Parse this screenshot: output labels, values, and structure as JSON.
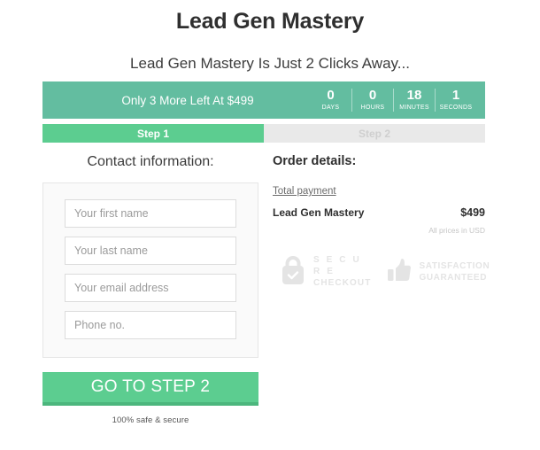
{
  "header": {
    "headline": "Lead Gen Mastery",
    "subheadline": "Lead Gen Mastery Is Just 2 Clicks Away..."
  },
  "countdown": {
    "scarcity_text": "Only 3 More Left At $499",
    "units": [
      {
        "value": "0",
        "label": "DAYS"
      },
      {
        "value": "0",
        "label": "HOURS"
      },
      {
        "value": "18",
        "label": "MINUTES"
      },
      {
        "value": "1",
        "label": "SECONDS"
      }
    ],
    "bar_color": "#63bda0"
  },
  "steps": {
    "active_label": "Step 1",
    "inactive_label": "Step 2",
    "active_color": "#5ccd90",
    "inactive_color": "#e9e9e9"
  },
  "contact": {
    "title": "Contact information:",
    "fields": [
      {
        "name": "first-name",
        "placeholder": "Your first name",
        "value": ""
      },
      {
        "name": "last-name",
        "placeholder": "Your last name",
        "value": ""
      },
      {
        "name": "email",
        "placeholder": "Your email address",
        "value": ""
      },
      {
        "name": "phone",
        "placeholder": "Phone no.",
        "value": ""
      }
    ],
    "cta_label": "GO TO STEP 2",
    "safe_note": "100% safe & secure"
  },
  "order": {
    "title": "Order details:",
    "total_payment_label": "Total payment",
    "item_name": "Lead Gen Mastery",
    "item_price": "$499",
    "currency_note": "All prices in USD"
  },
  "badges": [
    {
      "icon": "lock-check-icon",
      "line1": "S E C U R E",
      "line2": "CHECKOUT"
    },
    {
      "icon": "thumbs-up-icon",
      "line1": "SATISFACTION",
      "line2": "GUARANTEED"
    }
  ]
}
